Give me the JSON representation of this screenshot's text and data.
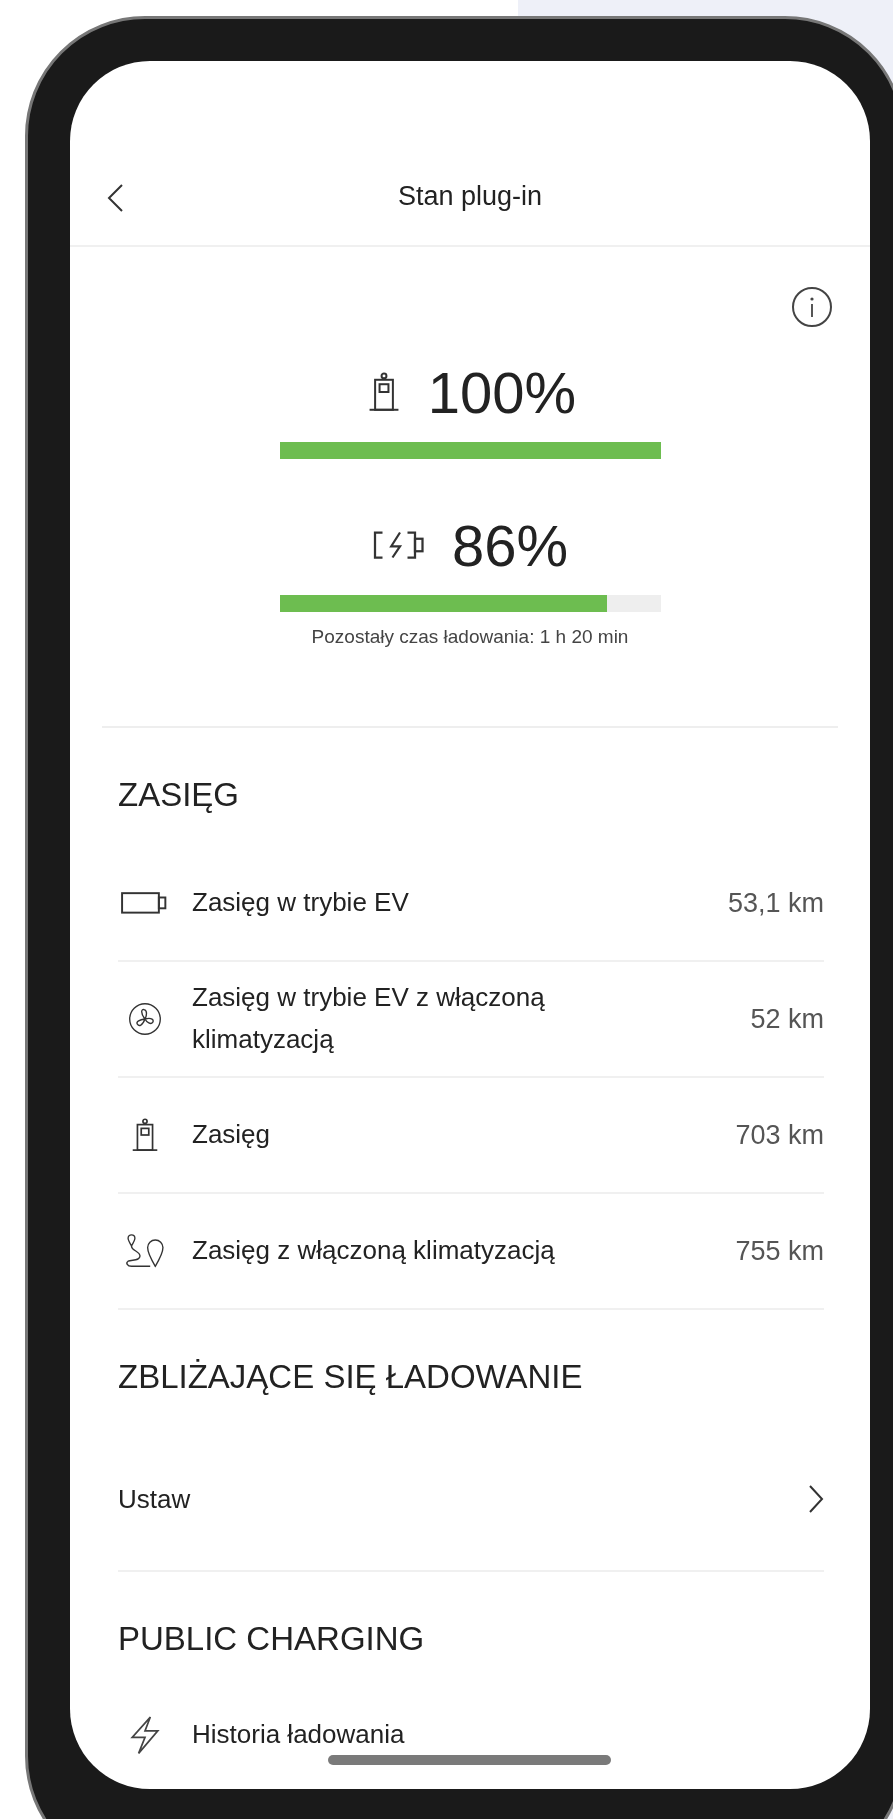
{
  "header": {
    "title": "Stan plug-in"
  },
  "levels": [
    {
      "kind": "fuel",
      "reading": "100%",
      "level": 1.0
    },
    {
      "kind": "battery",
      "reading": "86%",
      "level": 0.86
    }
  ],
  "charge_time": "Pozostały czas ładowania: 1 h 20 min",
  "range": {
    "title": "ZASIĘG",
    "rows": [
      {
        "kind": "battery",
        "label": "Zasięg w trybie EV",
        "value": "53,1 km"
      },
      {
        "kind": "fan",
        "label": "Zasięg w trybie EV z włączoną klimatyzacją",
        "value": "52 km"
      },
      {
        "kind": "fuel",
        "label": "Zasięg",
        "value": "703 km"
      },
      {
        "kind": "route",
        "label": "Zasięg z włączoną klimatyzacją",
        "value": "755 km"
      }
    ]
  },
  "upcoming": {
    "title": "ZBLIŻAJĄCE SIĘ ŁADOWANIE",
    "items": [
      {
        "label": "Ustaw"
      }
    ]
  },
  "public_charging": {
    "title": "PUBLIC CHARGING",
    "items": [
      {
        "kind": "bolt",
        "label": "Historia ładowania"
      }
    ]
  }
}
